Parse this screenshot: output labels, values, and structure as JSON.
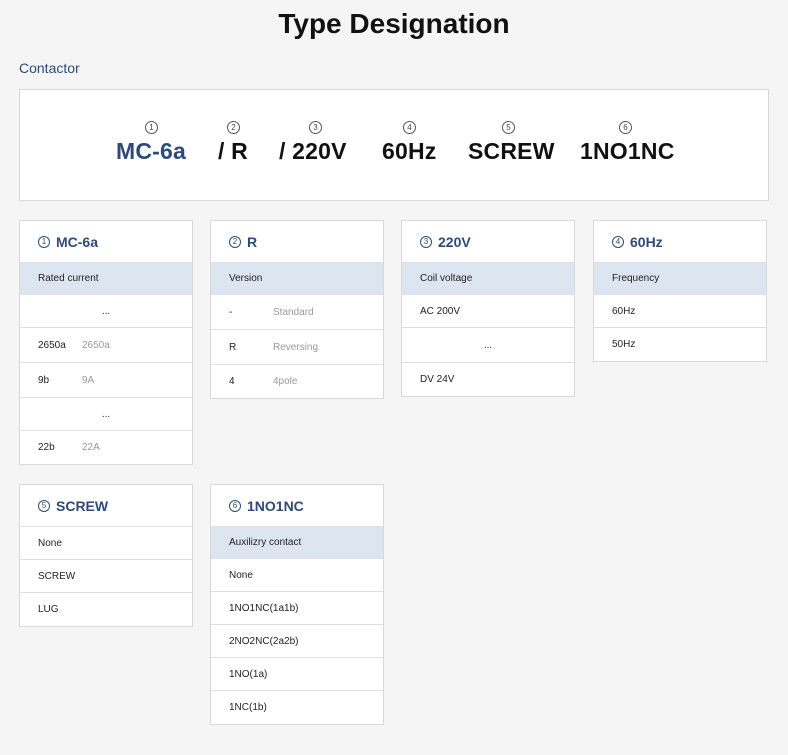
{
  "page": {
    "title": "Type Designation",
    "subtitle": "Contactor"
  },
  "code": [
    {
      "num": "1",
      "value": "MC-6a"
    },
    {
      "num": "2",
      "value": "/ R"
    },
    {
      "num": "3",
      "value": "/ 220V"
    },
    {
      "num": "4",
      "value": "60Hz"
    },
    {
      "num": "5",
      "value": "SCREW"
    },
    {
      "num": "6",
      "value": "1NO1NC"
    }
  ],
  "cards": {
    "c1": {
      "num": "1",
      "title": "MC-6a",
      "sub": "Rated current",
      "rows": [
        {
          "code": "...",
          "desc": ""
        },
        {
          "code": "2650a",
          "desc": "2650a"
        },
        {
          "code": "9b",
          "desc": "9A"
        },
        {
          "code": "...",
          "desc": ""
        },
        {
          "code": "22b",
          "desc": "22A"
        }
      ]
    },
    "c2": {
      "num": "2",
      "title": "R",
      "sub": "Version",
      "rows": [
        {
          "code": "-",
          "desc": "Standard"
        },
        {
          "code": "R",
          "desc": "Reversing"
        },
        {
          "code": "4",
          "desc": "4pole"
        }
      ]
    },
    "c3": {
      "num": "3",
      "title": "220V",
      "sub": "Coil voltage",
      "rows": [
        {
          "code": "AC 200V"
        },
        {
          "code": "..."
        },
        {
          "code": "DV 24V"
        }
      ]
    },
    "c4": {
      "num": "4",
      "title": "60Hz",
      "sub": "Frequency",
      "rows": [
        {
          "code": "60Hz"
        },
        {
          "code": "50Hz"
        }
      ]
    },
    "c5": {
      "num": "5",
      "title": "SCREW",
      "rows": [
        {
          "code": "None"
        },
        {
          "code": "SCREW"
        },
        {
          "code": "LUG"
        }
      ]
    },
    "c6": {
      "num": "6",
      "title": "1NO1NC",
      "sub": "Auxilizry contact",
      "rows": [
        {
          "code": "None"
        },
        {
          "code": "1NO1NC(1a1b)"
        },
        {
          "code": "2NO2NC(2a2b)"
        },
        {
          "code": "1NO(1a)"
        },
        {
          "code": "1NC(1b)"
        }
      ]
    }
  }
}
